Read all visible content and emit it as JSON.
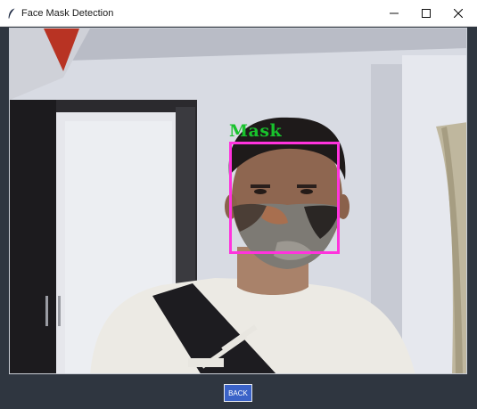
{
  "window": {
    "title": "Face Mask Detection",
    "icon": "feather-icon"
  },
  "controls": {
    "minimize_icon": "minimize-icon",
    "maximize_icon": "maximize-icon",
    "close_icon": "close-icon"
  },
  "detection": {
    "label": "Mask",
    "label_color": "#18c22c",
    "box_color": "#ff33dd"
  },
  "footer": {
    "back_label": "BACK",
    "button_color": "#3b63c8"
  }
}
